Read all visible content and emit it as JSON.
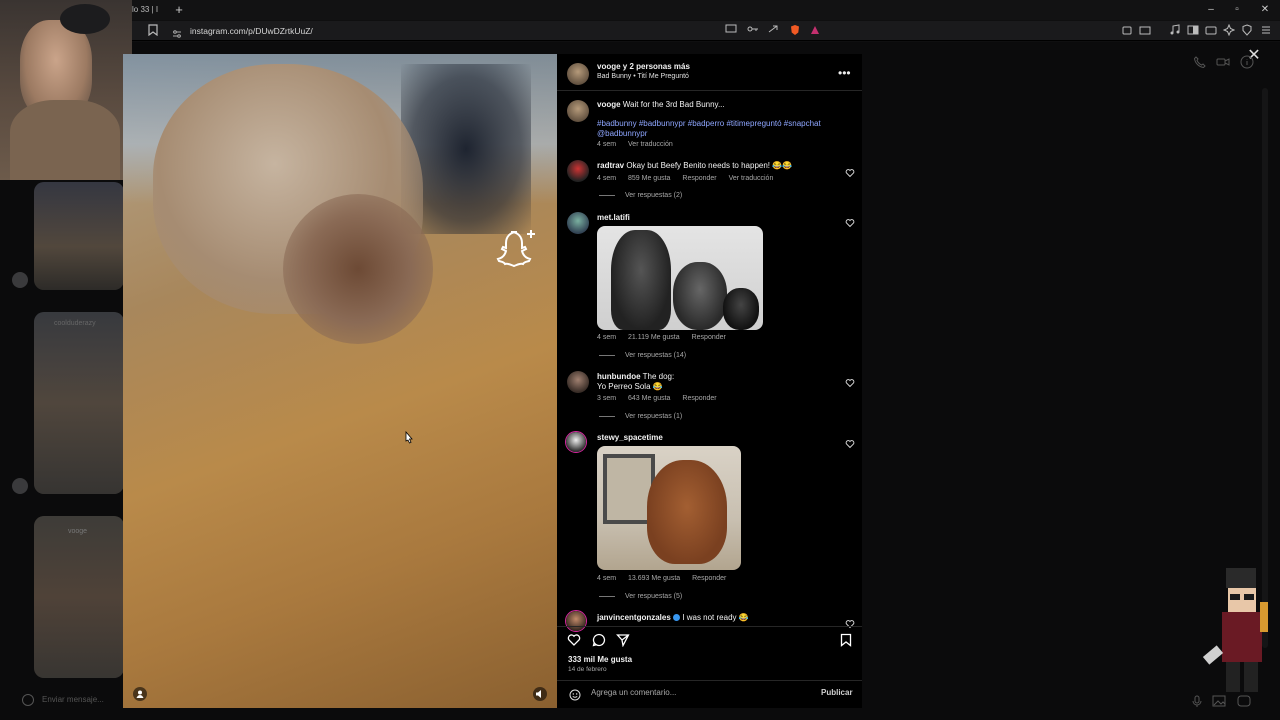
{
  "browser": {
    "tab_title": "lo 33 | I",
    "new_tab": "+",
    "url": "instagram.com/p/DUwDZrtkUuZ/",
    "window_controls": [
      "–",
      "▫",
      "✕"
    ]
  },
  "messenger": {
    "input_placeholder": "Enviar mensaje...",
    "thumb_user": "coolduderazy",
    "thumb_user2": "vooge"
  },
  "post": {
    "header_user": "vooge y 2 personas más",
    "header_audio": "Bad Bunny • Tití Me Preguntó",
    "caption_user": "vooge",
    "caption_text": "Wait for the 3rd Bad Bunny...",
    "hashtags": "#badbunny #badbunnypr #badperro #titimepreguntó #snapchat @badbunnypr",
    "caption_time": "4 sem",
    "caption_translate": "Ver traducción",
    "likes": "333 mil Me gusta",
    "date": "14 de febrero",
    "comment_placeholder": "Agrega un comentario...",
    "publish_label": "Publicar"
  },
  "comments": [
    {
      "user": "radtrav",
      "text": "Okay but Beefy Benito needs to happen! 😂😂",
      "time": "4 sem",
      "likes": "859 Me gusta",
      "reply": "Responder",
      "translate": "Ver traducción",
      "replies": "Ver respuestas (2)"
    },
    {
      "user": "met.latifi",
      "text": "",
      "time": "4 sem",
      "likes": "21.119 Me gusta",
      "reply": "Responder",
      "replies": "Ver respuestas (14)"
    },
    {
      "user": "hunbundoe",
      "text": "The dog:",
      "text2": "Yo Perreo Sola 😂",
      "time": "3 sem",
      "likes": "643 Me gusta",
      "reply": "Responder",
      "replies": "Ver respuestas (1)"
    },
    {
      "user": "stewy_spacetime",
      "text": "",
      "time": "4 sem",
      "likes": "13.693 Me gusta",
      "reply": "Responder",
      "replies": "Ver respuestas (5)"
    },
    {
      "user": "janvincentgonzales",
      "text": "I was not ready 😂"
    }
  ],
  "colors": {
    "panel_bg": "#000000",
    "hashtag": "#8ea6ff",
    "verified": "#3897f0"
  }
}
